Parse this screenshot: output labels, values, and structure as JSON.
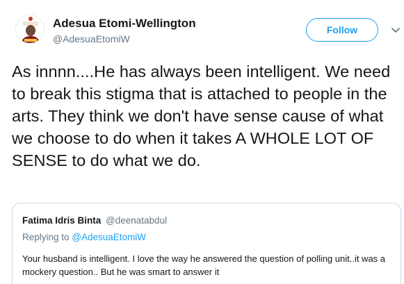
{
  "author": {
    "name": "Adesua Etomi-Wellington",
    "handle": "@AdesuaEtomiW",
    "avatar_icon": "profile-photo-avatar"
  },
  "actions": {
    "follow_label": "Follow",
    "menu_icon": "chevron-down-icon"
  },
  "tweet": {
    "text": "As innnn....He has always been intelligent. We need to break this stigma that is attached to people in the arts. They think we don't have sense cause of what we choose to do when it takes A WHOLE LOT OF SENSE to do what we do."
  },
  "quoted": {
    "name": "Fatima Idris Binta",
    "handle": "@deenatabdul",
    "replying_prefix": "Replying to",
    "replying_to": "@AdesuaEtomiW",
    "text": "Your husband is intelligent. I love the way he answered the question of polling unit..it was a mockery question.. But he was smart to answer it"
  },
  "colors": {
    "accent": "#1da1f2",
    "text": "#14171a",
    "secondary": "#657786",
    "border": "#ccd6dd"
  }
}
